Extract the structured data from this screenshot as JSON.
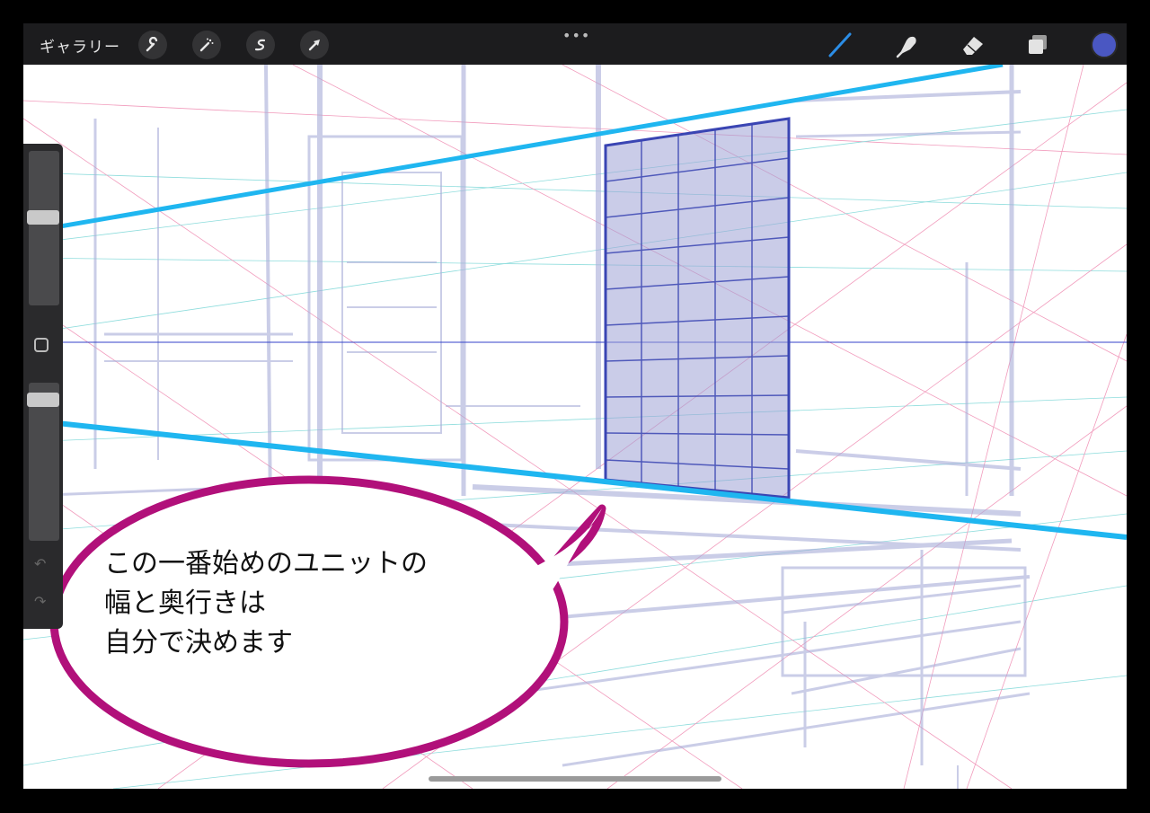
{
  "toolbar": {
    "gallery_label": "ギャラリー",
    "more_label": "•••",
    "left_tools": [
      "wrench-icon",
      "magic-wand-icon",
      "selection-icon",
      "transform-arrow-icon"
    ],
    "right_tools": [
      "brush-icon",
      "smudge-icon",
      "eraser-icon",
      "layers-icon"
    ],
    "active_color": "#4a57c2",
    "brush_active_color": "#2b8de6"
  },
  "sidebar": {
    "brush_size_level": 0.58,
    "opacity_level": 0.93,
    "modify_button": "square-icon",
    "undo_icon": "undo-icon",
    "redo_icon": "redo-icon"
  },
  "speech_bubble": {
    "lines": [
      "この一番始めのユニットの",
      "幅と奥行きは",
      "自分で決めます"
    ],
    "border_color": "#b1107a"
  },
  "colors": {
    "guide_cyan": "#1fb6f0",
    "horizon_blue": "#3342c8",
    "unit_fill": "#9ea3d6",
    "grid_pink": "#e64a86",
    "grid_teal": "#32c1c1",
    "sketch": "#a8acd8"
  }
}
